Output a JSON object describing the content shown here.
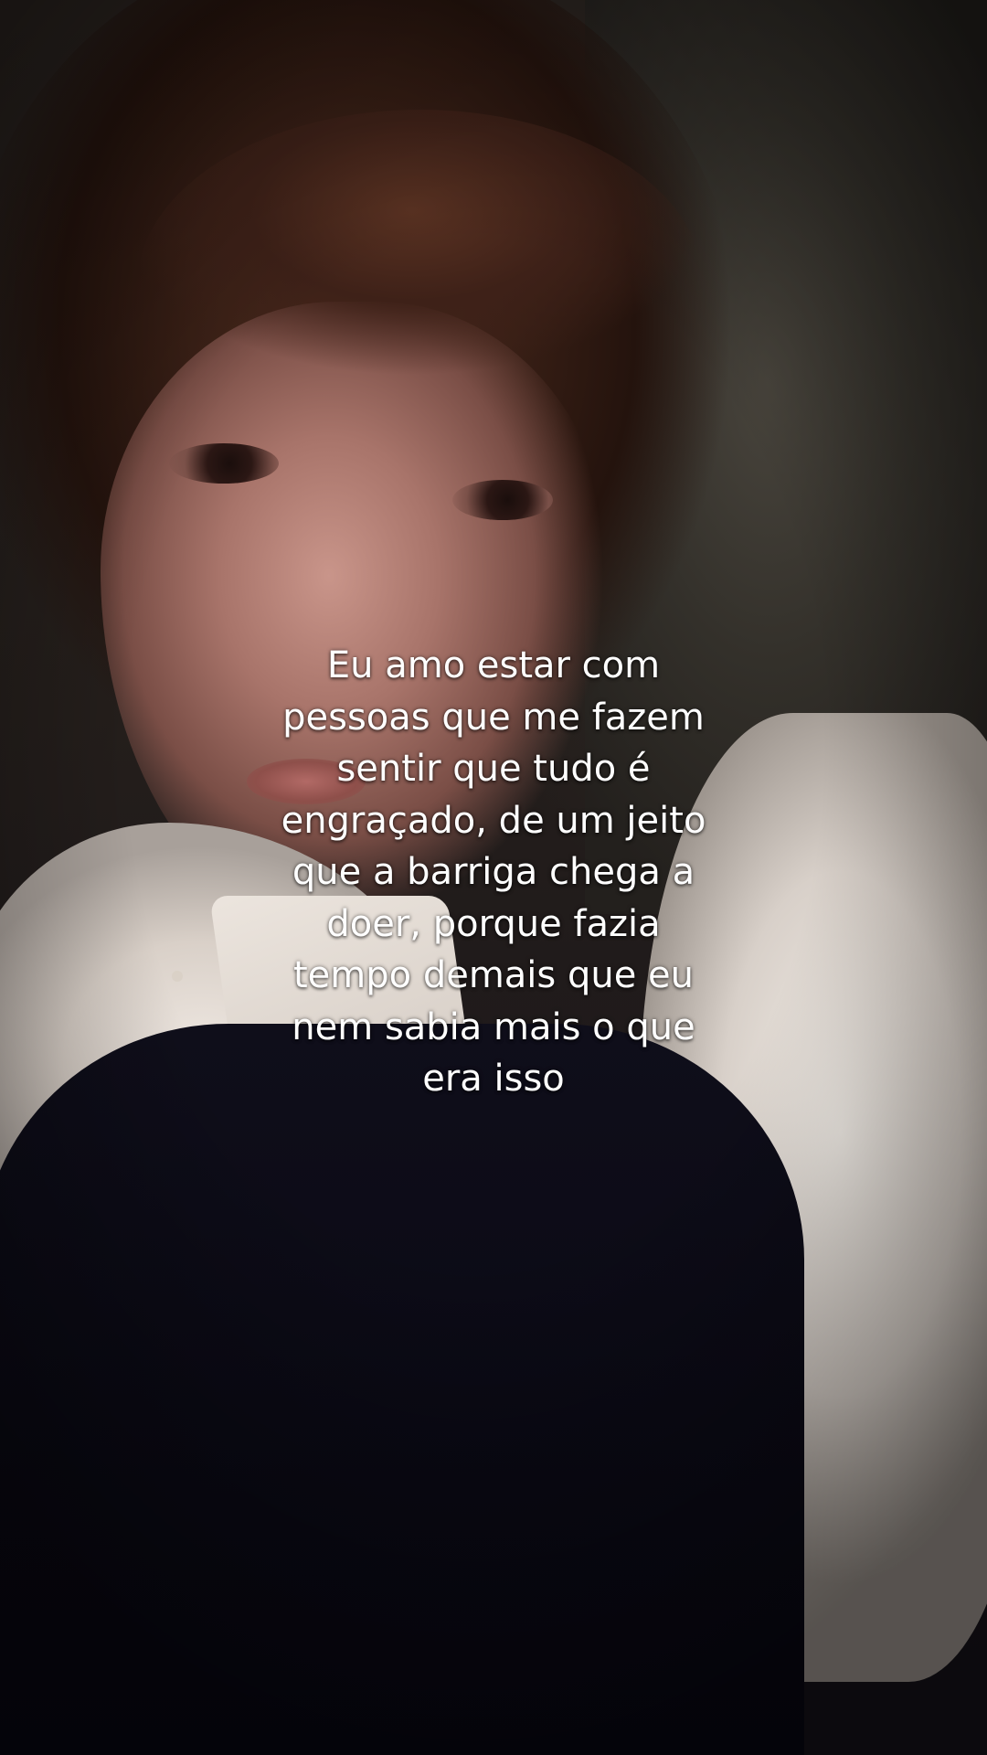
{
  "caption": {
    "text": "Eu amo estar com\npessoas que me fazem\nsentir que tudo é\nengraçado, de um jeito\nque a barriga chega a\ndoer, porque fazia\ntempo demais que eu\nnem sabia mais o que\nera isso"
  },
  "colors": {
    "caption_text": "#ffffff",
    "hair": "#3a2016",
    "shirt": "#efe8e2",
    "vest": "#0f0e1a",
    "background_wall": "#34312b"
  }
}
